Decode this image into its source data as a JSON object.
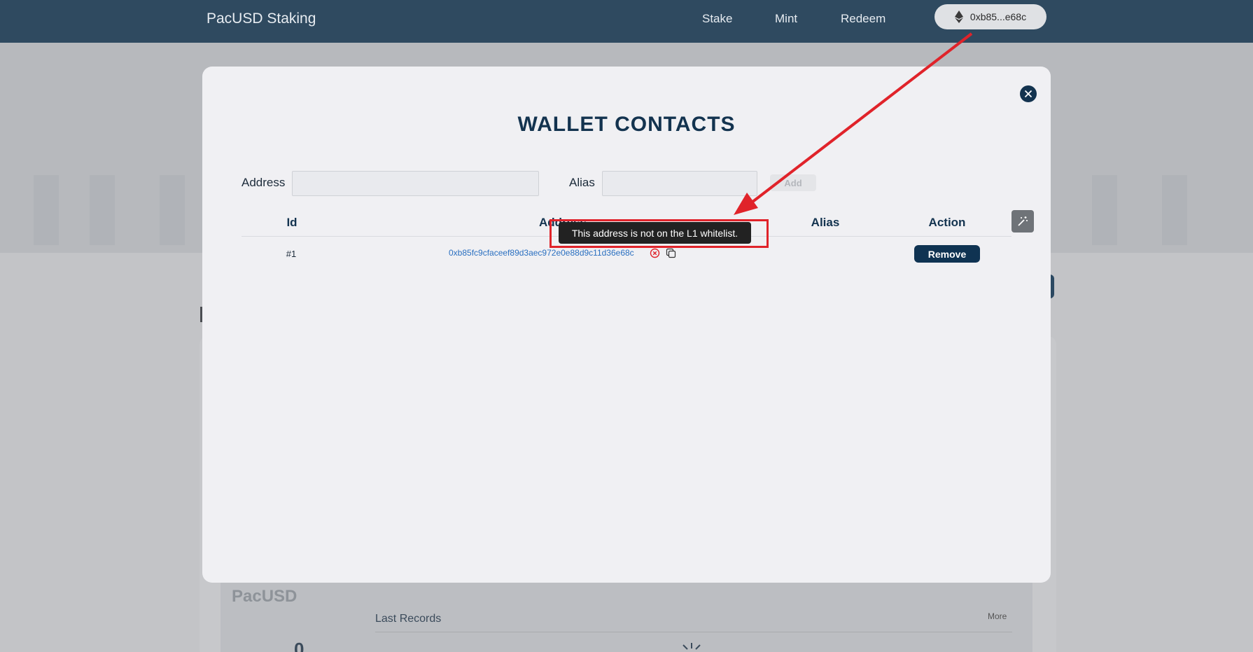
{
  "header": {
    "brand": "PacUSD Staking",
    "nav": [
      "Stake",
      "Mint",
      "Redeem"
    ],
    "wallet": "0xb85...e68c",
    "wallet_icon": "ethereum-icon"
  },
  "background": {
    "card_title": "PacUSD",
    "last_records": "Last Records",
    "more": "More",
    "stat_value": "0"
  },
  "modal": {
    "title": "WALLET CONTACTS",
    "address_label": "Address",
    "address_value": "",
    "alias_label": "Alias",
    "alias_value": "",
    "add_button": "Add",
    "columns": [
      "Id",
      "Address",
      "Alias",
      "Action"
    ],
    "rows": [
      {
        "id": "#1",
        "address": "0xb85fc9cfaceef89d3aec972e0e88d9c11d36e68c",
        "alias": "",
        "action": "Remove"
      }
    ],
    "tooltip": "This address is not on the L1 whitelist."
  },
  "annotation": {
    "color": "#e0232a"
  }
}
